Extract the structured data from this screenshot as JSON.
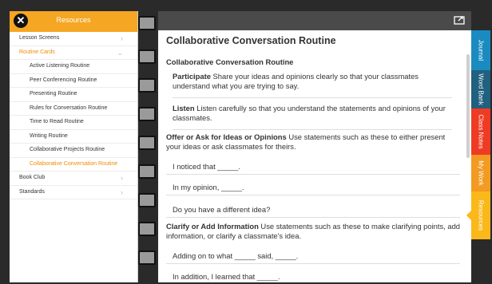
{
  "left_panel": {
    "title": "Resources",
    "close_icon": "close-icon",
    "items": [
      {
        "label": "Lesson Screens",
        "level": "top",
        "chevron": "›",
        "color": "default"
      },
      {
        "label": "Routine Cards",
        "level": "top",
        "chevron": "⌄",
        "color": "orange"
      },
      {
        "label": "Active Listening Routine",
        "level": "sub",
        "color": "default"
      },
      {
        "label": "Peer Conferencing Routine",
        "level": "sub",
        "color": "default"
      },
      {
        "label": "Presenting Routine",
        "level": "sub",
        "color": "default"
      },
      {
        "label": "Rules for Conversation Routine",
        "level": "sub",
        "color": "default"
      },
      {
        "label": "Time to Read Routine",
        "level": "sub",
        "color": "default"
      },
      {
        "label": "Writing Routine",
        "level": "sub",
        "color": "default"
      },
      {
        "label": "Collaborative Projects Routine",
        "level": "sub",
        "color": "default"
      },
      {
        "label": "Collaborative Conversation Routine",
        "level": "sub",
        "color": "orange"
      },
      {
        "label": "Book Club",
        "level": "top",
        "chevron": "›",
        "color": "default"
      },
      {
        "label": "Standards",
        "level": "top",
        "chevron": "›",
        "color": "default"
      }
    ]
  },
  "toolbar": {
    "export_icon": "export-icon"
  },
  "content": {
    "title": "Collaborative Conversation Routine",
    "subtitle": "Collaborative Conversation Routine",
    "participate": {
      "head": "Participate",
      "text": " Share your ideas and opinions clearly so that your classmates understand what you are trying to say."
    },
    "listen": {
      "head": "Listen",
      "text": " Listen carefully so that you understand the statements and opinions of your classmates."
    },
    "offer": {
      "head": "Offer or Ask for Ideas or Opinions",
      "text": " Use statements such as these to either present your ideas or ask classmates for theirs."
    },
    "offer_lines": [
      "I noticed that _____.",
      "In my opinion, _____.",
      "Do you have a different idea?"
    ],
    "clarify": {
      "head": "Clarify or Add Information",
      "text": " Use statements such as these to make clarifying points, add information, or clarify a classmate's idea."
    },
    "clarify_lines": [
      "Adding on to what _____ said, _____.",
      "In addition, I learned that _____."
    ]
  },
  "tabs": [
    "Journal",
    "Word Bank",
    "Class Notes",
    "My Work",
    "Resources"
  ],
  "colors": {
    "accent": "#f5a623",
    "journal": "#1a8bc0",
    "word_bank": "#21607f",
    "class_notes": "#ef3b24",
    "my_work": "#f29a22",
    "resources": "#fbb81b"
  }
}
